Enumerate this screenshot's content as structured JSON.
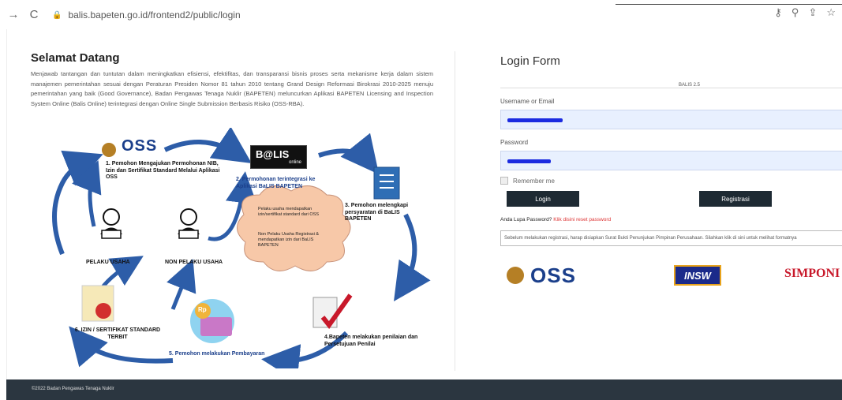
{
  "browser": {
    "url": "balis.bapeten.go.id/frontend2/public/login",
    "back_icon": "arrow-right-icon",
    "reload_icon": "reload-icon"
  },
  "welcome": {
    "title": "Selamat Datang",
    "text": "Menjawab tantangan dan tuntutan dalam meningkatkan efisiensi, efektifitas, dan transparansi bisnis proses serta mekanisme kerja dalam sistem manajemen pemerintahan sesuai dengan Peraturan Presiden Nomor 81 tahun 2010 tentang Grand Design Reformasi Birokrasi 2010-2025 menuju pemerintahan yang baik (Good Governance), Badan Pengawas Tenaga Nuklir (BAPETEN) meluncurkan Aplikasi BAPETEN Licensing and Inspection System Online (Balis Online) terintegrasi dengan Online Single Submission Berbasis Risiko (OSS-RBA)."
  },
  "diagram": {
    "oss_logo": "OSS",
    "balis_logo": "B@LIS",
    "balis_sub": "online",
    "step1": "1. Pemohon Mengajukan Permohonan NIB, Izin dan Sertifikat Standard Melalui Aplikasi OSS",
    "step2": "2. Permohonan terintegrasi ke Aplikasi BaLIS BAPETEN",
    "step3": "3. Pemohon melengkapi persyaratan di BaLIS BAPETEN",
    "step4": "4.Bapeten melakukan penilaian dan Persetujuan Penilai",
    "step5": "5. Pemohon melakukan Pembayaran",
    "step6": "6. IZIN / SERTIFIKAT STANDARD TERBIT",
    "pelaku": "PELAKU USAHA",
    "non_pelaku": "NON PELAKU USAHA",
    "cloud_1": "Pelaku usaha mendapatkan izin/sertifikat standard dari OSS",
    "cloud_2": "Non Pelaku Usaha Registrasi & mendapatkan izin dari BaLIS BAPETEN",
    "rp": "Rp"
  },
  "login": {
    "title": "Login Form",
    "version": "BALIS 2.5",
    "username_label": "Username or Email",
    "password_label": "Password",
    "remember_label": "Remember me",
    "login_button": "Login",
    "register_button": "Registrasi",
    "forgot_text": "Anda Lupa Password?",
    "forgot_link": "Klik disini reset password",
    "note": "Sebelum melakukan registrasi, harap disiapkan Surat Bukti Penunjukan Pimpinan Perusahaan. Silahkan klik di sini untuk melihat formatnya"
  },
  "logos": {
    "oss": "OSS",
    "insw": "INSW",
    "simponi": "SIMPONI"
  },
  "footer": {
    "text": "©2022 Badan Pengawas Tenaga Nuklir"
  },
  "colors": {
    "accent": "#1e2a33",
    "autofill": "#e8f0fe",
    "mask": "#1b2be0",
    "link": "#dd3333",
    "footer": "#2b3640"
  }
}
